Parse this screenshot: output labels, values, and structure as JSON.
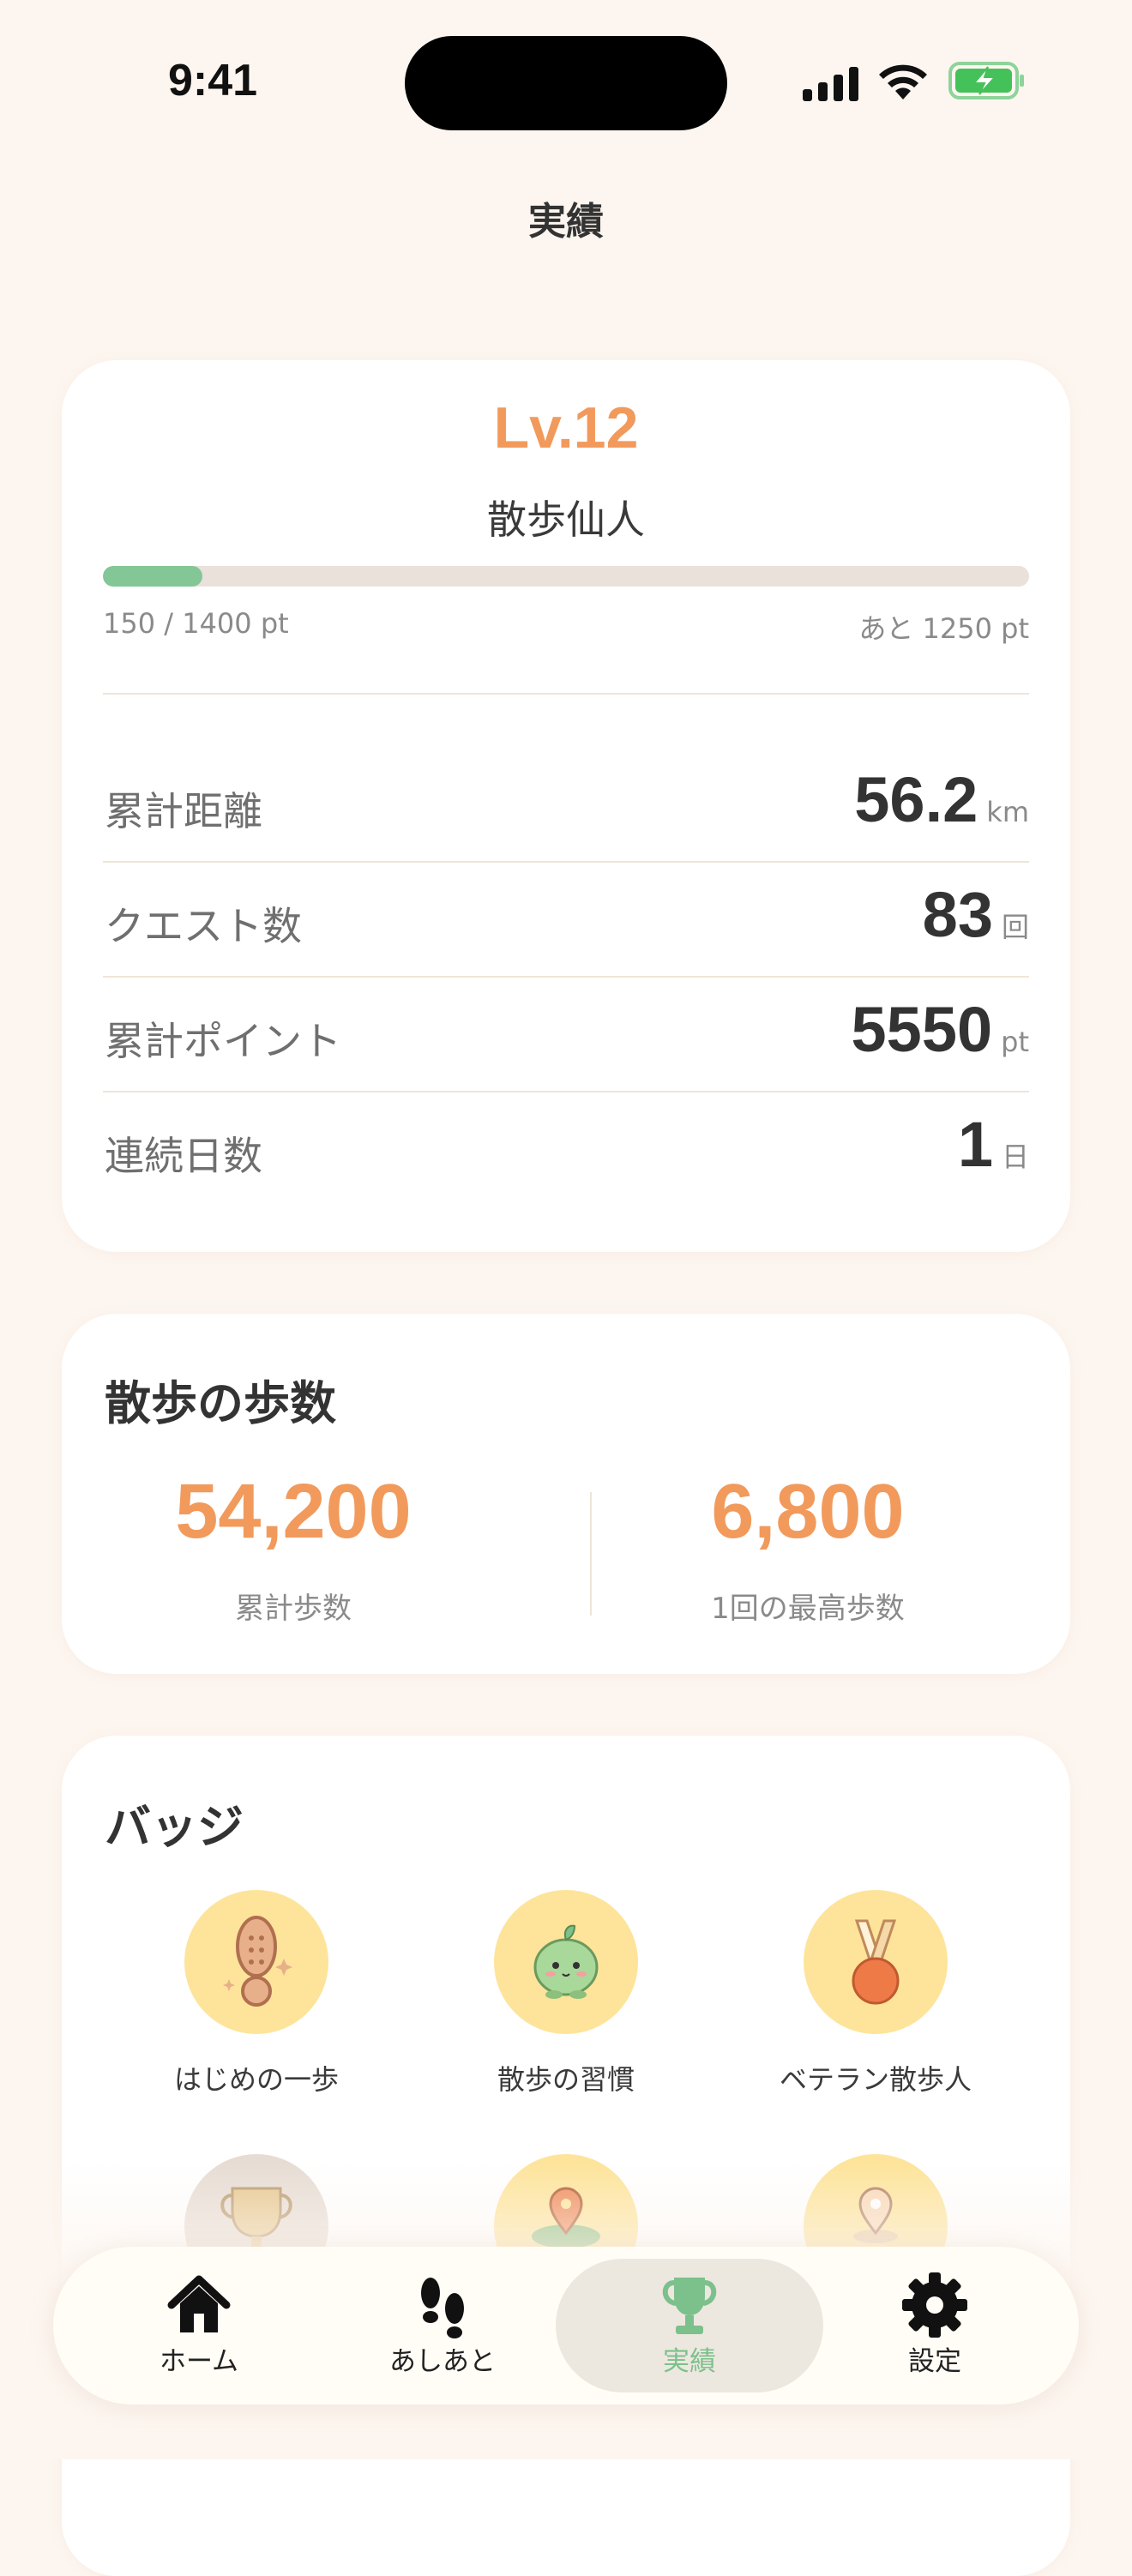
{
  "status_bar": {
    "time": "9:41"
  },
  "header": {
    "title": "実績"
  },
  "level_card": {
    "level": "Lv.12",
    "title": "散歩仙人",
    "progress_fraction": 0.107,
    "points_current": "150 / 1400 pt",
    "points_remaining": "あと 1250 pt",
    "stats": [
      {
        "label": "累計距離",
        "value": "56.2",
        "unit": "km"
      },
      {
        "label": "クエスト数",
        "value": "83",
        "unit": "回"
      },
      {
        "label": "累計ポイント",
        "value": "5550",
        "unit": "pt"
      },
      {
        "label": "連続日数",
        "value": "1",
        "unit": "日"
      }
    ]
  },
  "steps_card": {
    "title": "散歩の歩数",
    "total_value": "54,200",
    "total_label": "累計歩数",
    "best_value": "6,800",
    "best_label": "1回の最高歩数"
  },
  "badges_card": {
    "title": "バッジ",
    "badges": [
      {
        "label": "はじめの一歩",
        "icon": "shoe-sole-icon"
      },
      {
        "label": "散歩の習慣",
        "icon": "mascot-sprout-icon"
      },
      {
        "label": "ベテラン散歩人",
        "icon": "medal-icon"
      },
      {
        "label": "",
        "icon": "trophy-icon"
      },
      {
        "label": "",
        "icon": "map-pin-icon"
      },
      {
        "label": "",
        "icon": "map-pin-icon"
      }
    ]
  },
  "tab_bar": {
    "tabs": [
      {
        "label": "ホーム",
        "icon": "home-icon"
      },
      {
        "label": "あしあと",
        "icon": "footprints-icon"
      },
      {
        "label": "実績",
        "icon": "trophy-icon",
        "active": true
      },
      {
        "label": "設定",
        "icon": "gear-icon"
      }
    ],
    "active_color": "#7cc08c"
  },
  "colors": {
    "accent": "#f19a5c",
    "progress": "#82c795",
    "background": "#fdf6f0"
  }
}
